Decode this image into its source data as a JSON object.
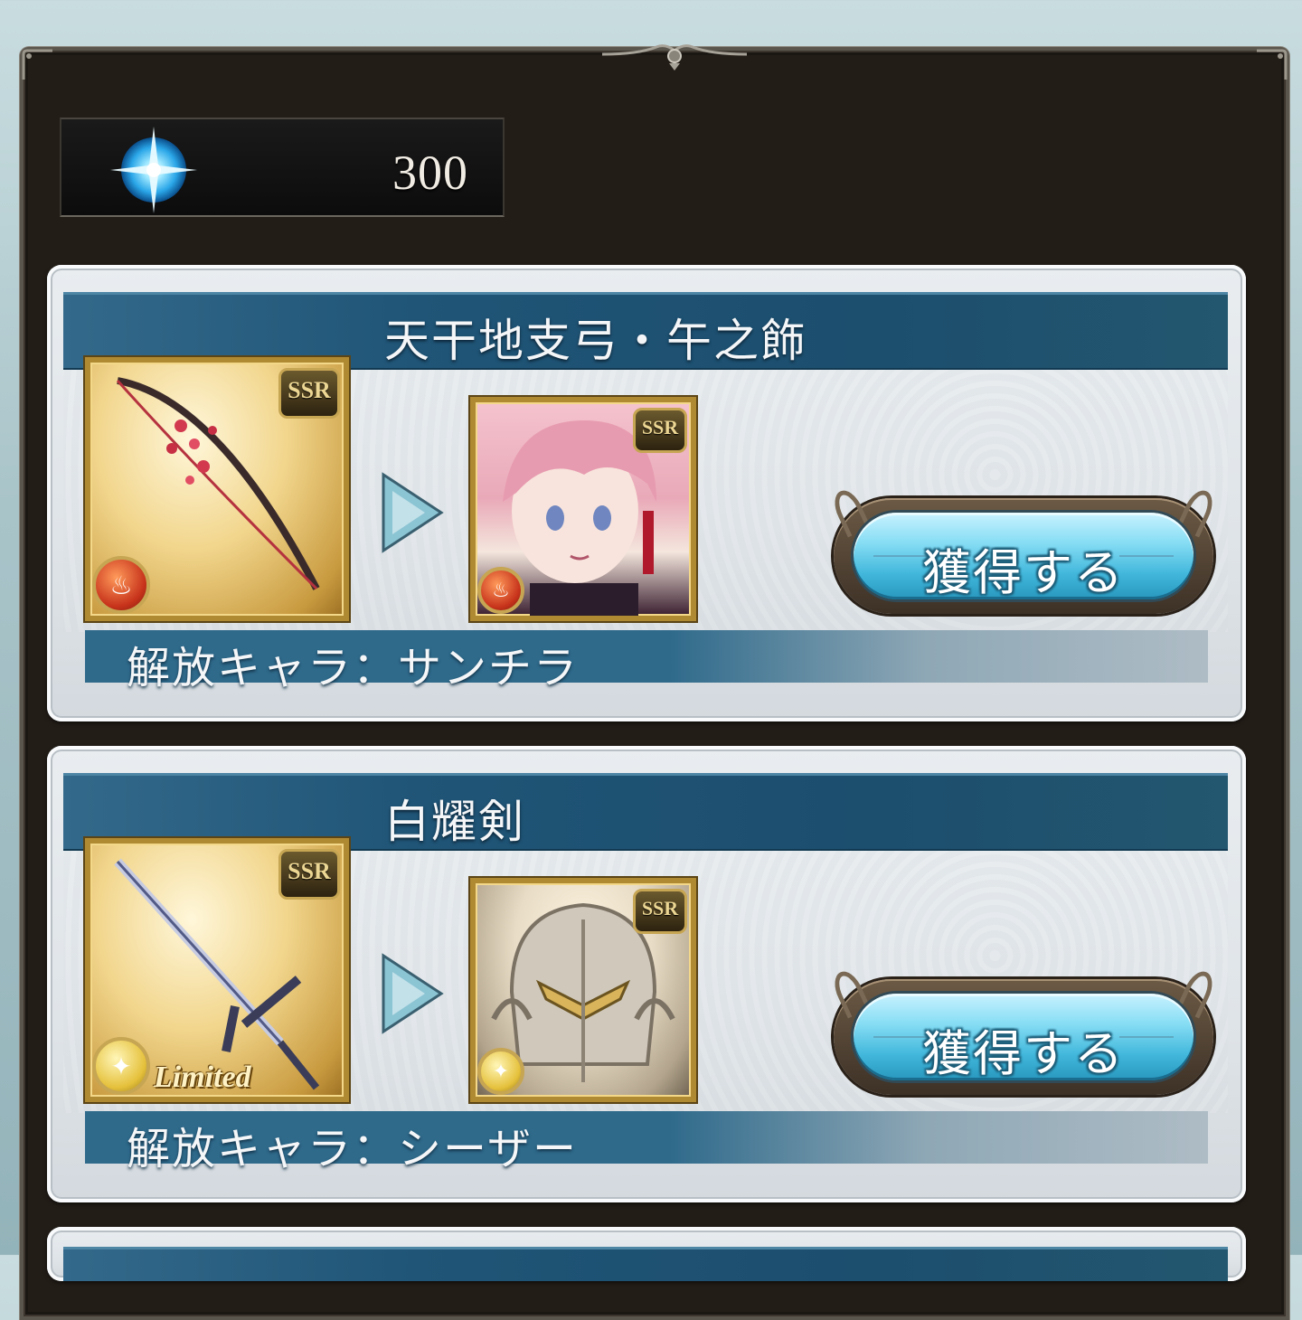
{
  "currency": {
    "icon": "crystal-icon",
    "amount": "300"
  },
  "items": [
    {
      "weapon_name": "天干地支弓・午之飾",
      "weapon_rarity": "SSR",
      "weapon_element": "fire",
      "character_rarity": "SSR",
      "character_element": "fire",
      "button_label": "獲得する",
      "release_text": "解放キャラ：サンチラ"
    },
    {
      "weapon_name": "白耀剣",
      "weapon_rarity": "SSR",
      "weapon_element": "light",
      "weapon_badge": "Limited",
      "character_rarity": "SSR",
      "character_element": "light",
      "button_label": "獲得する",
      "release_text": "解放キャラ：シーザー"
    }
  ],
  "colors": {
    "header": "#205577",
    "button": "#42b8dc",
    "frame": "#231d17"
  }
}
